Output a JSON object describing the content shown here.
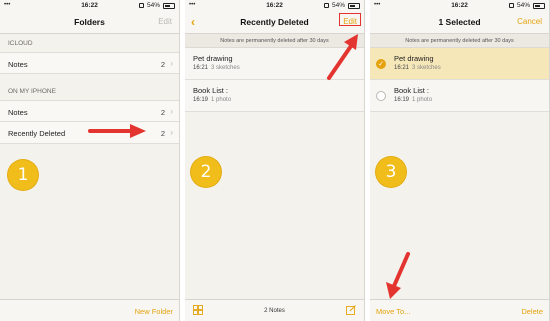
{
  "status": {
    "time": "16:22",
    "battery": "54%",
    "carrier": "•••"
  },
  "panel1": {
    "title": "Folders",
    "edit_label": "Edit",
    "sections": [
      {
        "header": "ICLOUD",
        "rows": [
          {
            "label": "Notes",
            "count": "2"
          }
        ]
      },
      {
        "header": "ON MY IPHONE",
        "rows": [
          {
            "label": "Notes",
            "count": "2"
          },
          {
            "label": "Recently Deleted",
            "count": "2"
          }
        ]
      }
    ],
    "new_folder_label": "New Folder",
    "badge": "1"
  },
  "panel2": {
    "title": "Recently Deleted",
    "edit_label": "Edit",
    "info": "Notes are permanently deleted after 30 days",
    "notes": [
      {
        "title": "Pet drawing",
        "time": "16:21",
        "sub": "3 sketches"
      },
      {
        "title": "Book List :",
        "time": "16:19",
        "sub": "1 photo"
      }
    ],
    "count_label": "2 Notes",
    "badge": "2"
  },
  "panel3": {
    "title": "1 Selected",
    "cancel_label": "Cancel",
    "info": "Notes are permanently deleted after 30 days",
    "notes": [
      {
        "title": "Pet drawing",
        "time": "16:21",
        "sub": "3 sketches",
        "selected": true
      },
      {
        "title": "Book List :",
        "time": "16:19",
        "sub": "1 photo",
        "selected": false
      }
    ],
    "move_label": "Move To...",
    "delete_label": "Delete",
    "badge": "3"
  },
  "colors": {
    "accent": "#e5a30f",
    "arrow": "#e3342f",
    "badge": "#f0bd1b",
    "selected_row": "#f5e7b8"
  }
}
